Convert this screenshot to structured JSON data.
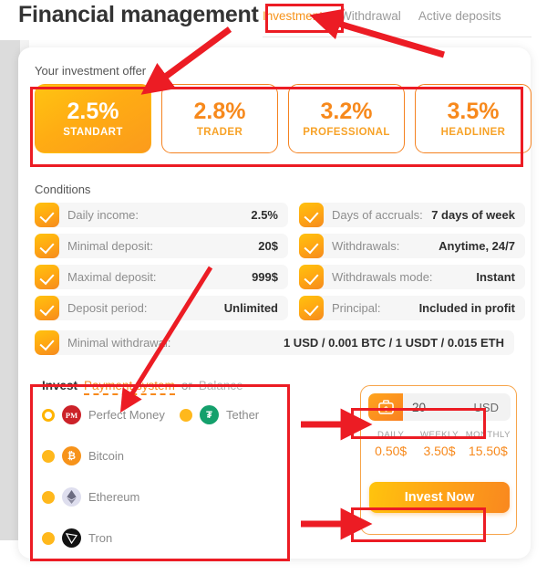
{
  "header": {
    "title": "Financial management",
    "tabs": [
      {
        "label": "Investment",
        "active": true
      },
      {
        "label": "Withdrawal",
        "active": false
      },
      {
        "label": "Active deposits",
        "active": false
      }
    ]
  },
  "offer": {
    "section_label": "Your investment offer",
    "plans": [
      {
        "percent": "2.5%",
        "name": "STANDART",
        "selected": true
      },
      {
        "percent": "2.8%",
        "name": "TRADER",
        "selected": false
      },
      {
        "percent": "3.2%",
        "name": "PROFESSIONAL",
        "selected": false
      },
      {
        "percent": "3.5%",
        "name": "HEADLINER",
        "selected": false
      }
    ]
  },
  "conditions": {
    "section_label": "Conditions",
    "left": [
      {
        "key": "Daily income:",
        "value": "2.5%"
      },
      {
        "key": "Minimal deposit:",
        "value": "20$"
      },
      {
        "key": "Maximal deposit:",
        "value": "999$"
      },
      {
        "key": "Deposit period:",
        "value": "Unlimited"
      }
    ],
    "right": [
      {
        "key": "Days of accruals:",
        "value": "7 days of week"
      },
      {
        "key": "Withdrawals:",
        "value": "Anytime, 24/7"
      },
      {
        "key": "Withdrawals mode:",
        "value": "Instant"
      },
      {
        "key": "Principal:",
        "value": "Included in profit"
      }
    ],
    "wide": {
      "key": "Minimal withdrawal:",
      "value": "1 USD / 0.001 BTC / 1 USDT / 0.015 ETH"
    }
  },
  "invest": {
    "label": "Invest",
    "payment_system": "Payment system",
    "or": "or",
    "balance": "Balance",
    "methods": [
      {
        "name": "Perfect Money",
        "symbol": "PM",
        "selected": true,
        "color": "#cc2229"
      },
      {
        "name": "Tether",
        "symbol": "T",
        "selected": false,
        "color": "#14a06c"
      },
      {
        "name": "Bitcoin",
        "symbol": "B",
        "selected": false,
        "color": "#f7931a"
      },
      {
        "name": "Ethereum",
        "symbol": "",
        "selected": false,
        "color": "#dedeee"
      },
      {
        "name": "Tron",
        "symbol": "",
        "selected": false,
        "color": "#121212"
      }
    ]
  },
  "amount": {
    "value": "20",
    "placeholder": "20",
    "currency": "USD",
    "icon": "briefcase-dollar-icon"
  },
  "projection": {
    "daily_label": "DAILY",
    "daily_value": "0.50$",
    "weekly_label": "WEEKLY",
    "weekly_value": "3.50$",
    "monthly_label": "MONTHLY",
    "monthly_value": "15.50$"
  },
  "cta": {
    "invest_now": "Invest Now"
  },
  "colors": {
    "accent": "#f7891c",
    "accent_light": "#ffc20e",
    "annotation": "#ec1c24",
    "muted": "#9a9a9a"
  }
}
